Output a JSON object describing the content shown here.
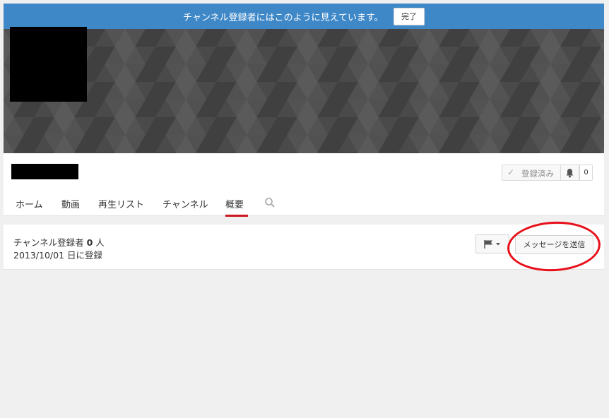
{
  "preview_banner": {
    "message": "チャンネル登録者にはこのように見えています。",
    "done_label": "完了",
    "color": "#3f88c8"
  },
  "channel": {
    "subscribe_label": "登録済み",
    "subscribe_icon": "check-icon",
    "notification_icon": "bell-icon",
    "subscriber_count": "0"
  },
  "tabs": [
    {
      "label": "ホーム",
      "active": false
    },
    {
      "label": "動画",
      "active": false
    },
    {
      "label": "再生リスト",
      "active": false
    },
    {
      "label": "チャンネル",
      "active": false
    },
    {
      "label": "概要",
      "active": true
    }
  ],
  "tab_search_icon": "search-icon",
  "about": {
    "subscribers_prefix": "チャンネル登録者 ",
    "subscribers_count": "0",
    "subscribers_suffix": " 人",
    "joined": "2013/10/01 日に登録",
    "flag_icon": "flag-icon",
    "send_message_label": "メッセージを送信"
  },
  "colors": {
    "active_tab_underline": "#cc181e",
    "annotation_circle": "#e8101a",
    "page_background": "#f0f0f0"
  }
}
